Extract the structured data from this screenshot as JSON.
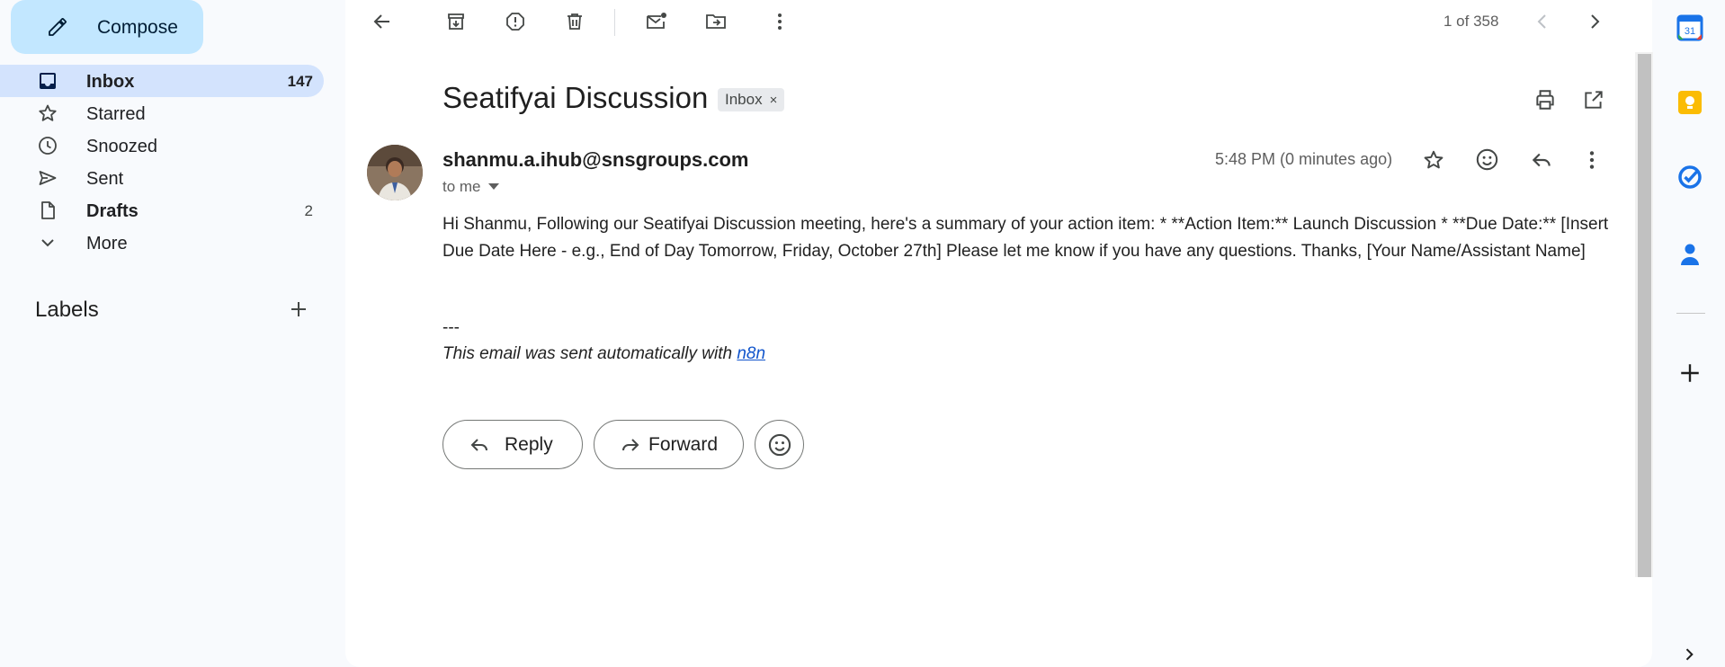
{
  "compose": {
    "label": "Compose"
  },
  "nav": [
    {
      "label": "Inbox",
      "count": "147"
    },
    {
      "label": "Starred",
      "count": ""
    },
    {
      "label": "Snoozed",
      "count": ""
    },
    {
      "label": "Sent",
      "count": ""
    },
    {
      "label": "Drafts",
      "count": "2"
    },
    {
      "label": "More",
      "count": ""
    }
  ],
  "labels": {
    "heading": "Labels"
  },
  "toolbar": {
    "pager": "1 of 358"
  },
  "email": {
    "subject": "Seatifyai Discussion",
    "chip": "Inbox",
    "chip_close": "×",
    "sender": "shanmu.a.ihub@snsgroups.com",
    "to": "to me",
    "timestamp": "5:48 PM (0 minutes ago)",
    "body": "Hi Shanmu, Following our Seatifyai Discussion meeting, here's a summary of your action item: * **Action Item:** Launch Discussion * **Due Date:** [Insert Due Date Here - e.g., End of Day Tomorrow, Friday, October 27th] Please let me know if you have any questions. Thanks, [Your Name/Assistant Name]",
    "sig_dash": "---",
    "sig_text": "This email was sent automatically with ",
    "sig_link": "n8n"
  },
  "actions": {
    "reply": "Reply",
    "forward": "Forward"
  },
  "sidepanel": {
    "calendar_day": "31"
  },
  "colors": {
    "compose_bg": "#c2e7ff",
    "active_nav_bg": "#d3e3fd",
    "link": "#1155cc",
    "calendar_blue": "#1a73e8",
    "keep_yellow": "#fbbc04",
    "tasks_blue": "#1a73e8",
    "contacts_blue": "#1a73e8"
  }
}
